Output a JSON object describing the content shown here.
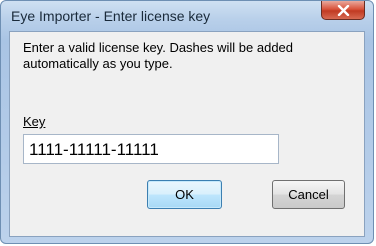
{
  "window": {
    "title": "Eye Importer - Enter license key",
    "close_icon": "close-icon"
  },
  "dialog": {
    "message": "Enter a valid license key. Dashes will be added automatically as you type.",
    "key_label": "Key",
    "key_value": "1111-11111-11111",
    "ok_label": "OK",
    "cancel_label": "Cancel"
  },
  "colors": {
    "titlebar": "#b9d0ea",
    "close_button": "#d9533c",
    "client_bg": "#f0f0f0"
  }
}
